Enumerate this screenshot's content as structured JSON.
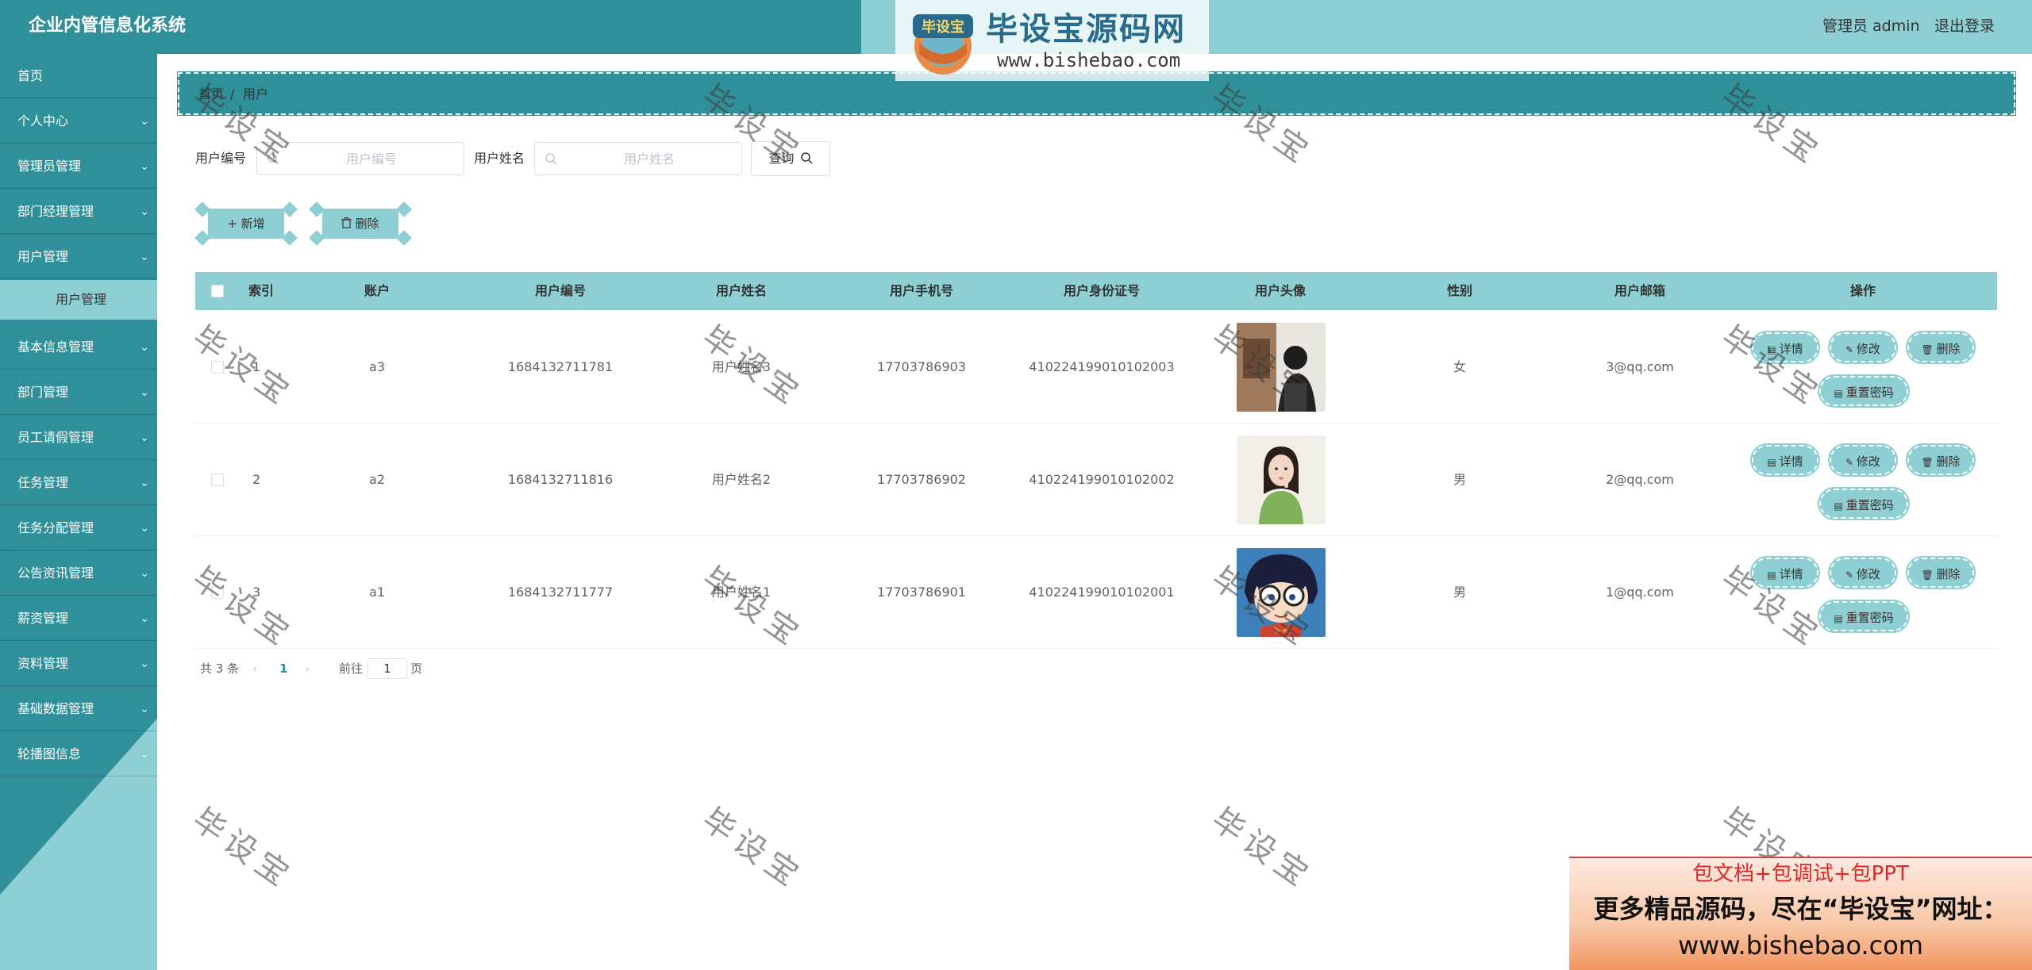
{
  "header": {
    "app_title": "企业内管信息化系统",
    "admin_label": "管理员 admin",
    "logout": "退出登录"
  },
  "watermark_banner": {
    "seal": "毕设宝",
    "big_text": "毕设宝源码网",
    "url": "www.bishebao.com"
  },
  "sidebar": {
    "items": [
      {
        "label": "首页",
        "has_chevron": false
      },
      {
        "label": "个人中心",
        "has_chevron": true
      },
      {
        "label": "管理员管理",
        "has_chevron": true
      },
      {
        "label": "部门经理管理",
        "has_chevron": true
      },
      {
        "label": "用户管理",
        "has_chevron": true
      },
      {
        "label": "基本信息管理",
        "has_chevron": true
      },
      {
        "label": "部门管理",
        "has_chevron": true
      },
      {
        "label": "员工请假管理",
        "has_chevron": true
      },
      {
        "label": "任务管理",
        "has_chevron": true
      },
      {
        "label": "任务分配管理",
        "has_chevron": true
      },
      {
        "label": "公告资讯管理",
        "has_chevron": true
      },
      {
        "label": "薪资管理",
        "has_chevron": true
      },
      {
        "label": "资料管理",
        "has_chevron": true
      },
      {
        "label": "基础数据管理",
        "has_chevron": true
      },
      {
        "label": "轮播图信息",
        "has_chevron": true
      }
    ],
    "active_sub": "用户管理"
  },
  "breadcrumb": {
    "home": "首页",
    "current": "用户"
  },
  "search": {
    "label_code": "用户编号",
    "placeholder_code": "用户编号",
    "value_code": "",
    "label_name": "用户姓名",
    "placeholder_name": "用户姓名",
    "value_name": "",
    "query_button": "查询"
  },
  "actions": {
    "add": "+ 新增",
    "delete": "删除"
  },
  "table": {
    "headers": [
      "索引",
      "账户",
      "用户编号",
      "用户姓名",
      "用户手机号",
      "用户身份证号",
      "用户头像",
      "性别",
      "用户邮箱",
      "操作"
    ],
    "rows": [
      {
        "index": "1",
        "account": "a3",
        "code": "1684132711781",
        "name": "用户姓名3",
        "phone": "17703786903",
        "id_card": "410224199010102003",
        "avatar": "photo-person-back",
        "gender": "女",
        "email": "3@qq.com"
      },
      {
        "index": "2",
        "account": "a2",
        "code": "1684132711816",
        "name": "用户姓名2",
        "phone": "17703786902",
        "id_card": "410224199010102002",
        "avatar": "photo-girl-green",
        "gender": "男",
        "email": "2@qq.com"
      },
      {
        "index": "3",
        "account": "a1",
        "code": "1684132711777",
        "name": "用户姓名1",
        "phone": "17703786901",
        "id_card": "410224199010102001",
        "avatar": "photo-cartoon-boy",
        "gender": "男",
        "email": "1@qq.com"
      }
    ],
    "row_actions": {
      "detail": "详情",
      "edit": "修改",
      "delete": "删除",
      "reset_password": "重置密码"
    }
  },
  "pagination": {
    "total": "共 3 条",
    "current_page": "1",
    "goto_label": "前往",
    "goto_value": "1",
    "page_suffix": "页"
  },
  "watermark_text": "毕设宝",
  "ad": {
    "line1": "包文档+包调试+包PPT",
    "line2": "更多精品源码，尽在“毕设宝”网址：",
    "line3": "www.bishebao.com"
  },
  "colors": {
    "primary_dark": "#2f9099",
    "primary_light": "#8ecfd4",
    "active_page": "#2f9099"
  }
}
